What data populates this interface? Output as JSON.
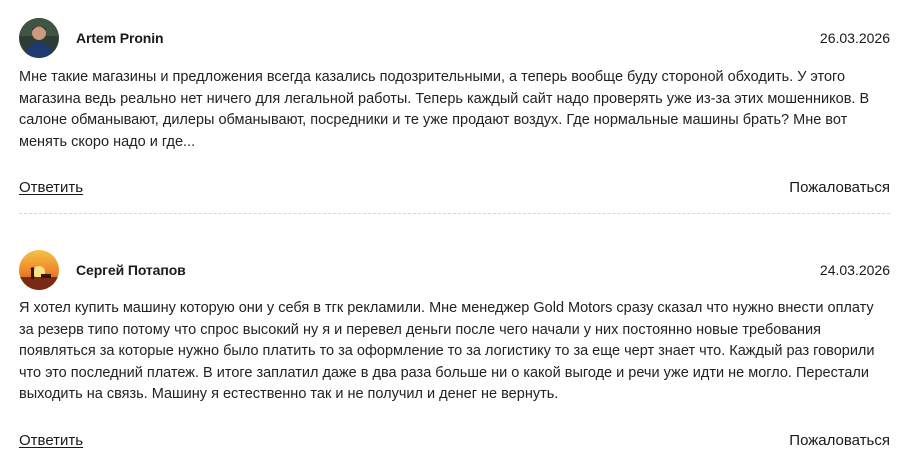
{
  "comments": [
    {
      "author": "Artem Pronin",
      "date": "26.03.2026",
      "text": "Мне такие магазины и предложения всегда казались подозрительными, а теперь вообще буду стороной обходить. У этого магазина ведь реально нет ничего для легальной работы. Теперь каждый сайт надо проверять уже из-за этих мошенников. В салоне обманывают, дилеры обманывают, посредники и те уже продают воздух. Где нормальные машины брать? Мне вот менять скоро надо и где...",
      "reply_label": "Ответить",
      "report_label": "Пожаловаться"
    },
    {
      "author": "Сергей Потапов",
      "date": "24.03.2026",
      "text": "Я хотел купить машину которую они у себя в тгк рекламили. Мне менеджер Gold Motors сразу сказал что нужно внести оплату за резерв типо потому что спрос высокий ну я и перевел деньги после чего начали у них постоянно новые требования появляться за которые нужно было платить то за оформление то за логистику то за еще черт знает что. Каждый раз говорили что это последний платеж. В итоге заплатил даже в два раза больше ни о какой выгоде и речи уже идти не могло. Перестали выходить на связь. Машину я естественно так и не получил и денег не вернуть.",
      "reply_label": "Ответить",
      "report_label": "Пожаловаться"
    }
  ]
}
